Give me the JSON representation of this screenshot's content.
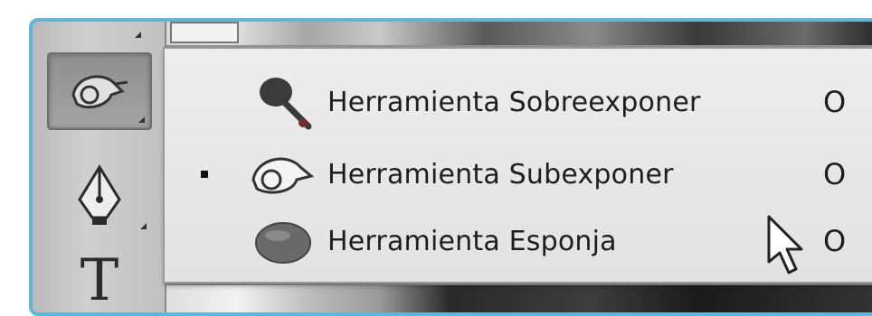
{
  "colors": {
    "frame_border": "#5ab8d8",
    "menu_background": "#e8e8e8",
    "toolbar_background": "#c4c4c4",
    "text": "#1e1e1e"
  },
  "toolbar": {
    "tools": [
      {
        "name": "dodge-tool",
        "icon": "dodge-icon",
        "selected": true
      },
      {
        "name": "pen-tool",
        "icon": "pen-icon",
        "selected": false
      },
      {
        "name": "type-tool",
        "icon": "type-icon",
        "label": "T",
        "selected": false
      }
    ]
  },
  "flyout_menu": {
    "items": [
      {
        "label": "Herramienta Sobreexponer",
        "shortcut": "O",
        "icon": "burn-icon",
        "checked": false
      },
      {
        "label": "Herramienta Subexponer",
        "shortcut": "O",
        "icon": "dodge-icon",
        "checked": true
      },
      {
        "label": "Herramienta Esponja",
        "shortcut": "O",
        "icon": "sponge-icon",
        "checked": false
      }
    ]
  }
}
